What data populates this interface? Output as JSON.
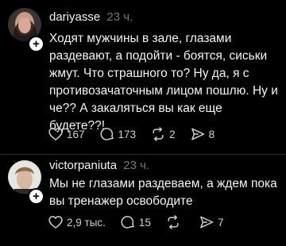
{
  "posts": [
    {
      "username": "dariyasse",
      "time": "23 ч.",
      "text": "Ходят мужчины в зале, глазами раздевают, а подойти - боятся, сиськи жмут. Что страшного то? Ну да, я с противозачаточным лицом пошлю. Ну и че?? А закаляться вы как еще будете??!",
      "likes": "167",
      "replies": "173",
      "reposts": "2",
      "shares": "8"
    },
    {
      "username": "victorpaniuta",
      "time": "23 ч.",
      "text": "Мы не глазами раздеваем, а ждем пока вы тренажер освободите",
      "likes": "2,9 тыс.",
      "replies": "15",
      "reposts": "",
      "shares": "7"
    }
  ],
  "icons": {
    "like": "heart-icon",
    "reply": "comment-icon",
    "repost": "repost-icon",
    "share": "send-icon",
    "follow": "plus-icon"
  },
  "colors": {
    "background": "#000000",
    "text": "#f3f5f7",
    "muted": "#777777"
  }
}
